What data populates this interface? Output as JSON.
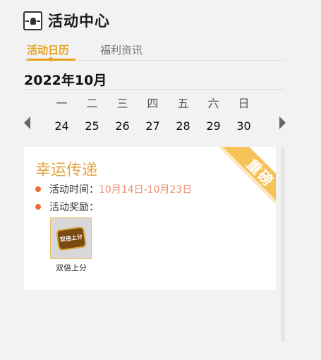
{
  "header": {
    "title": "活动中心",
    "logo_icon": "app-logo-icon"
  },
  "tabs": [
    {
      "label": "活动日历",
      "active": true
    },
    {
      "label": "福利资讯",
      "active": false
    }
  ],
  "calendar": {
    "month": "2022年10月",
    "weekdays": [
      "一",
      "二",
      "三",
      "四",
      "五",
      "六",
      "日"
    ],
    "days": [
      "24",
      "25",
      "26",
      "27",
      "28",
      "29",
      "30"
    ]
  },
  "event": {
    "title": "幸运传递",
    "ribbon": "重磅",
    "time_label": "活动时间：",
    "time_value": "10月14日-10月23日",
    "reward_label": "活动奖励：",
    "rewards": [
      {
        "name": "双倍上分",
        "badge_text": "双倍上分"
      }
    ]
  },
  "colors": {
    "accent": "#e8a21c",
    "title": "#e4a545",
    "bullet": "#ec6a3a",
    "highlight": "#ea8f6f",
    "ribbon": "#f6c35a"
  }
}
